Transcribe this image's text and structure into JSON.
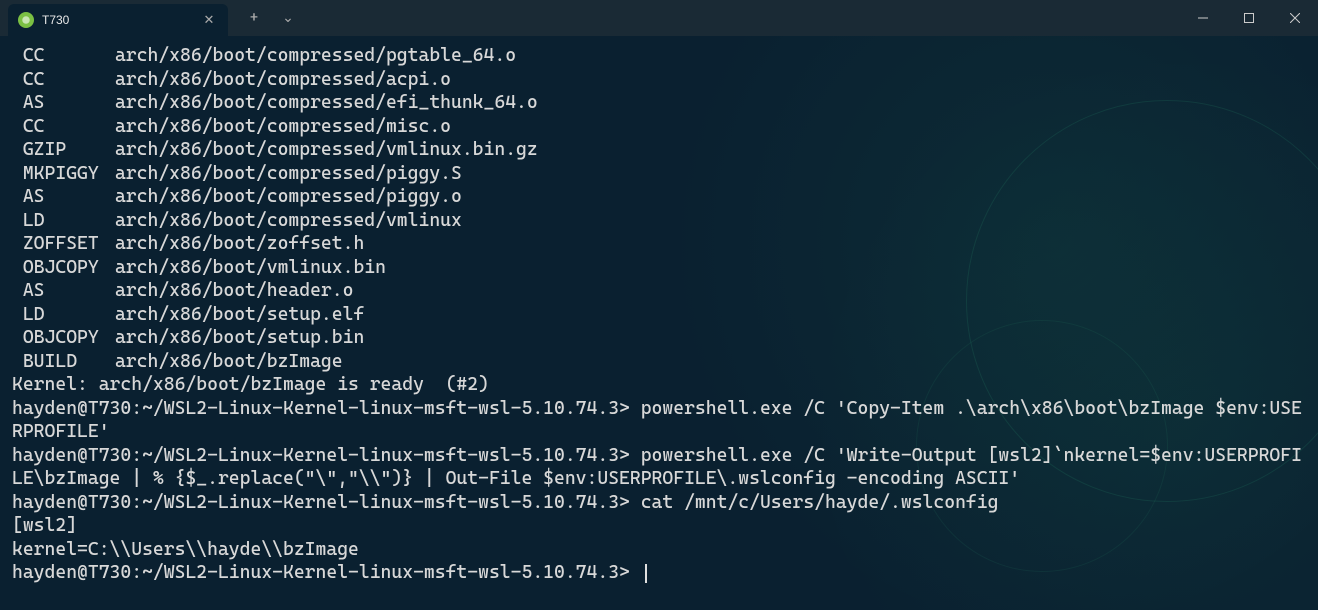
{
  "window": {
    "tab_title": "T730",
    "new_tab_label": "+",
    "dropdown_label": "⌄"
  },
  "build_lines": [
    {
      "action": "CC",
      "path": "arch/x86/boot/compressed/pgtable_64.o"
    },
    {
      "action": "CC",
      "path": "arch/x86/boot/compressed/acpi.o"
    },
    {
      "action": "AS",
      "path": "arch/x86/boot/compressed/efi_thunk_64.o"
    },
    {
      "action": "CC",
      "path": "arch/x86/boot/compressed/misc.o"
    },
    {
      "action": "GZIP",
      "path": "arch/x86/boot/compressed/vmlinux.bin.gz"
    },
    {
      "action": "MKPIGGY",
      "path": "arch/x86/boot/compressed/piggy.S"
    },
    {
      "action": "AS",
      "path": "arch/x86/boot/compressed/piggy.o"
    },
    {
      "action": "LD",
      "path": "arch/x86/boot/compressed/vmlinux"
    },
    {
      "action": "ZOFFSET",
      "path": "arch/x86/boot/zoffset.h"
    },
    {
      "action": "OBJCOPY",
      "path": "arch/x86/boot/vmlinux.bin"
    },
    {
      "action": "AS",
      "path": "arch/x86/boot/header.o"
    },
    {
      "action": "LD",
      "path": "arch/x86/boot/setup.elf"
    },
    {
      "action": "OBJCOPY",
      "path": "arch/x86/boot/setup.bin"
    },
    {
      "action": "BUILD",
      "path": "arch/x86/boot/bzImage"
    }
  ],
  "kernel_ready": "Kernel: arch/x86/boot/bzImage is ready  (#2)",
  "prompt": "hayden@T730:~/WSL2-Linux-Kernel-linux-msft-wsl-5.10.74.3>",
  "cmd1": "powershell.exe /C 'Copy-Item .\\arch\\x86\\boot\\bzImage $env:USERPROFILE'",
  "cmd2": "powershell.exe /C 'Write-Output [wsl2]`nkernel=$env:USERPROFILE\\bzImage | % {$_.replace(\"\\\",\"\\\\\")} | Out-File $env:USERPROFILE\\.wslconfig -encoding ASCII'",
  "cmd3": "cat /mnt/c/Users/hayde/.wslconfig",
  "output3_line1": "[wsl2]",
  "output3_line2": "kernel=C:\\\\Users\\\\hayde\\\\bzImage"
}
